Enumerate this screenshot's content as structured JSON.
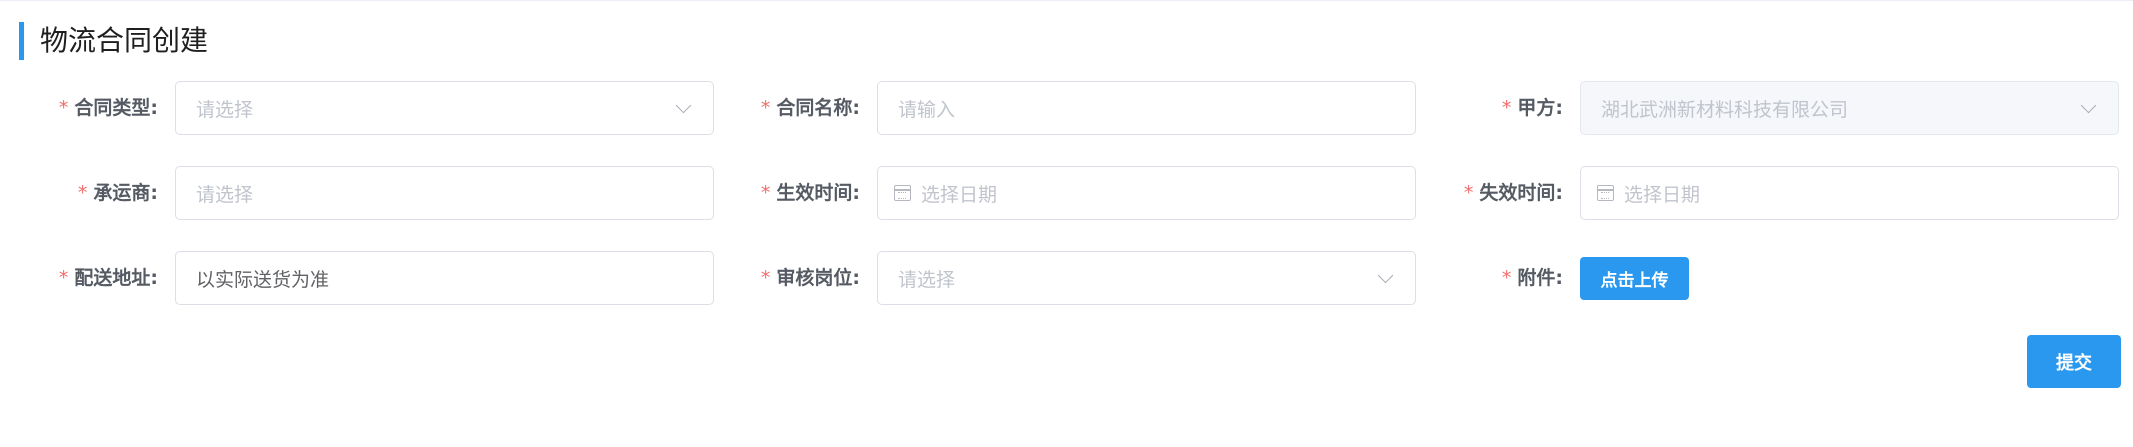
{
  "page": {
    "title": "物流合同创建"
  },
  "form": {
    "contract_type": {
      "label": "合同类型:",
      "placeholder": "请选择"
    },
    "contract_name": {
      "label": "合同名称:",
      "placeholder": "请输入"
    },
    "party_a": {
      "label": "甲方:",
      "value": "湖北武洲新材料科技有限公司"
    },
    "carrier": {
      "label": "承运商:",
      "placeholder": "请选择"
    },
    "effective_date": {
      "label": "生效时间:",
      "placeholder": "选择日期"
    },
    "expiry_date": {
      "label": "失效时间:",
      "placeholder": "选择日期"
    },
    "delivery_address": {
      "label": "配送地址:",
      "value": "以实际送货为准"
    },
    "review_position": {
      "label": "审核岗位:",
      "placeholder": "请选择"
    },
    "attachment": {
      "label": "附件:",
      "button": "点击上传"
    },
    "required_mark": "*"
  },
  "actions": {
    "submit": "提交"
  },
  "colors": {
    "accent": "#2a98ee",
    "required": "#f56c6c"
  },
  "icons": {
    "select": "chevron-down-icon",
    "date": "calendar-icon"
  }
}
